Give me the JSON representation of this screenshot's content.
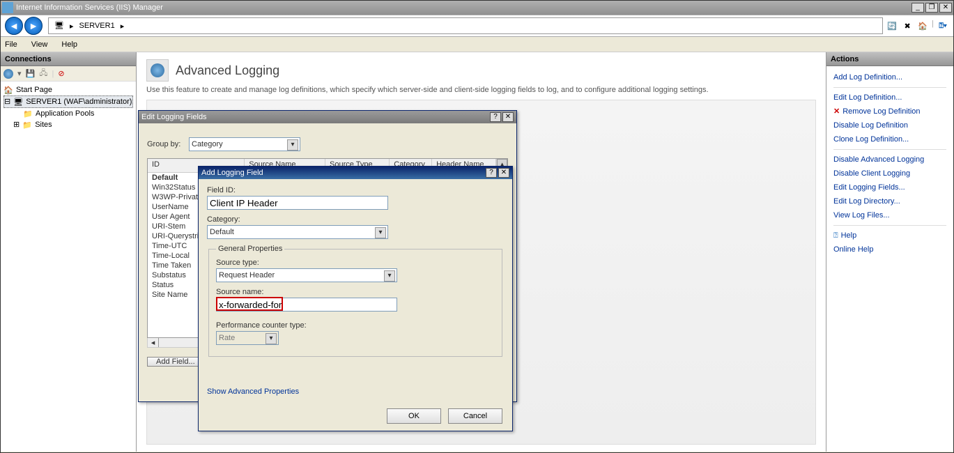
{
  "window": {
    "title": "Internet Information Services (IIS) Manager"
  },
  "breadcrumb": {
    "server": "SERVER1"
  },
  "menu": {
    "file": "File",
    "view": "View",
    "help": "Help"
  },
  "connections": {
    "header": "Connections",
    "start": "Start Page",
    "server": "SERVER1 (WAF\\administrator)",
    "apppools": "Application Pools",
    "sites": "Sites"
  },
  "main": {
    "title": "Advanced Logging",
    "desc": "Use this feature to create and manage log definitions, which specify which server-side and client-side logging fields to log, and to configure additional logging settings."
  },
  "actions": {
    "header": "Actions",
    "addDef": "Add Log Definition...",
    "editDef": "Edit Log Definition...",
    "removeDef": "Remove Log Definition",
    "disableDef": "Disable Log Definition",
    "cloneDef": "Clone Log Definition...",
    "disableAdv": "Disable Advanced Logging",
    "disableClient": "Disable Client Logging",
    "editFields": "Edit Logging Fields...",
    "editDir": "Edit Log Directory...",
    "viewLog": "View Log Files...",
    "help": "Help",
    "online": "Online Help"
  },
  "dlg1": {
    "title": "Edit Logging Fields",
    "groupByLabel": "Group by:",
    "groupByValue": "Category",
    "cols": {
      "id": "ID",
      "srcname": "Source Name",
      "srctype": "Source Type",
      "cat": "Category",
      "hdrname": "Header Name"
    },
    "rows": [
      "Default",
      "Win32Status",
      "W3WP-PrivateBytes",
      "UserName",
      "User Agent",
      "URI-Stem",
      "URI-Querystring",
      "Time-UTC",
      "Time-Local",
      "Time Taken",
      "Substatus",
      "Status",
      "Site Name"
    ],
    "addField": "Add Field..."
  },
  "dlg2": {
    "title": "Add Logging Field",
    "fieldIdLabel": "Field ID:",
    "fieldIdValue": "Client IP Header",
    "categoryLabel": "Category:",
    "categoryValue": "Default",
    "gpLegend": "General Properties",
    "srcTypeLabel": "Source type:",
    "srcTypeValue": "Request Header",
    "srcNameLabel": "Source name:",
    "srcNameValue": "x-forwarded-for",
    "perfLabel": "Performance counter type:",
    "perfValue": "Rate",
    "showAdv": "Show Advanced Properties",
    "ok": "OK",
    "cancel": "Cancel"
  }
}
